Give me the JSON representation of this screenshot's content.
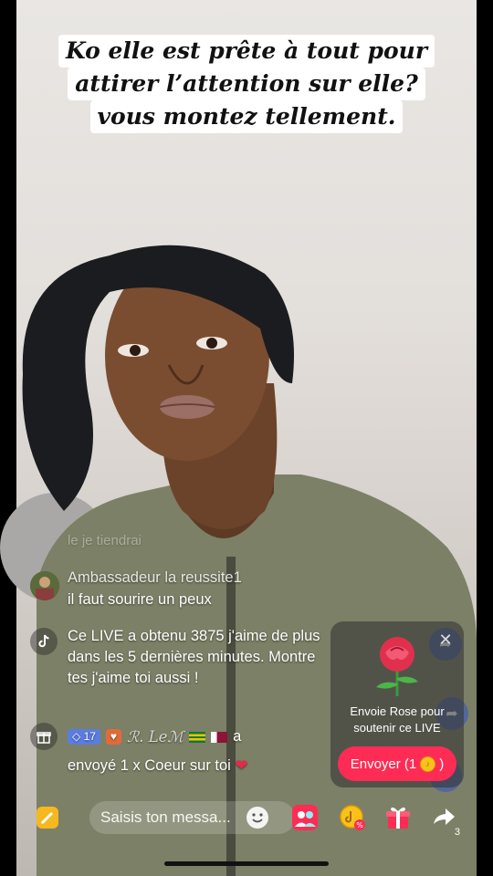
{
  "caption": {
    "line1": "Ko elle est prête à tout pour",
    "line2": "attirer l’attention sur elle?",
    "line3": "vous montez tellement."
  },
  "chat": {
    "faded_comment": "le je tiendrai",
    "comment1": {
      "username": "Ambassadeur la reussite1",
      "text": "il faut sourire un peux"
    },
    "system_message": "Ce LIVE a obtenu 3875 j'aime de plus dans les 5 dernières minutes. Montre tes j'aime toi aussi !",
    "gift_message": {
      "level": "17",
      "name": "ℛ. Leℳ",
      "suffix": "a",
      "text": "envoyé 1 x Coeur sur toi"
    }
  },
  "gift_panel": {
    "title": "Envoie Rose pour soutenir ce LIVE",
    "button_label": "Envoyer (1"
  },
  "toolbar": {
    "input_placeholder": "Saisis ton messa...",
    "share_count": "3"
  },
  "colors": {
    "accent": "#fe2c55",
    "coin": "#f7c31b",
    "level_badge": "#5a7de0"
  }
}
